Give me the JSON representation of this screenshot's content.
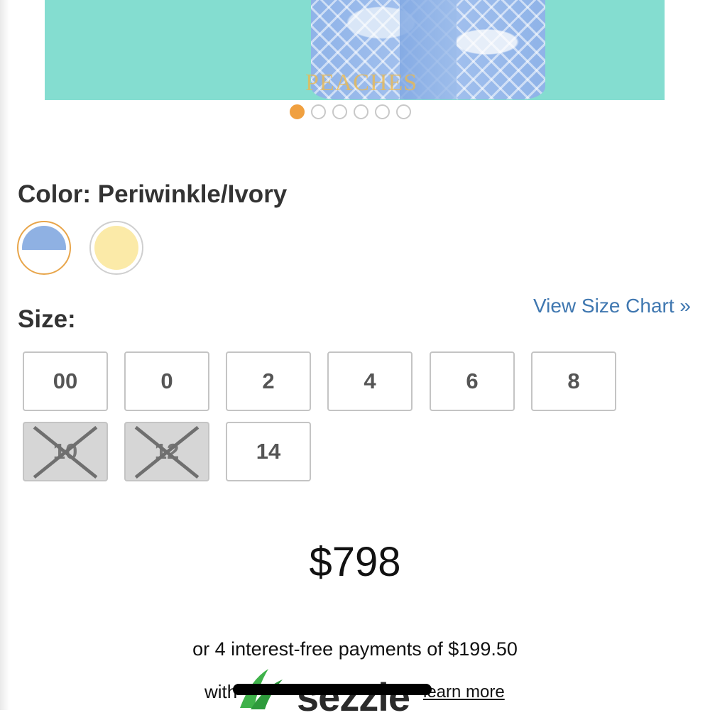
{
  "hero": {
    "brand_logo": "PEACHES",
    "carousel_total": 6,
    "carousel_active_index": 0
  },
  "colors": {
    "label": "Color: Periwinkle/Ivory",
    "swatches": [
      {
        "name": "Periwinkle/Ivory",
        "selected": true,
        "top_color": "#8fb1e3",
        "bottom_color": "#ffffff"
      },
      {
        "name": "Ivory",
        "selected": false,
        "color": "#fbeaa8"
      }
    ]
  },
  "size": {
    "label": "Size:",
    "chart_link": "View Size Chart »",
    "options": [
      {
        "value": "00",
        "available": true
      },
      {
        "value": "0",
        "available": true
      },
      {
        "value": "2",
        "available": true
      },
      {
        "value": "4",
        "available": true
      },
      {
        "value": "6",
        "available": true
      },
      {
        "value": "8",
        "available": true
      },
      {
        "value": "10",
        "available": false
      },
      {
        "value": "12",
        "available": false
      },
      {
        "value": "14",
        "available": true
      }
    ]
  },
  "price": {
    "amount": "$798",
    "installments_text": "or 4 interest-free payments of $199.50",
    "with_text": "with",
    "provider": "sezzle",
    "learn_more": "learn more"
  },
  "theme": {
    "accent": "#f0a040",
    "link": "#3f77b0",
    "hero_bg": "#84ddd0"
  }
}
